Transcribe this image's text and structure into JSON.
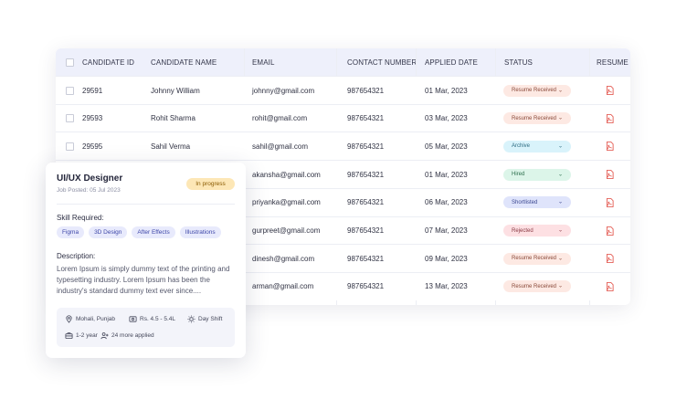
{
  "table": {
    "headers": {
      "id": "CANDIDATE ID",
      "name": "CANDIDATE NAME",
      "email": "EMAIL",
      "contact": "CONTACT NUMBER",
      "applied": "APPLIED DATE",
      "status": "STATUS",
      "resume": "RESUME"
    },
    "rows": [
      {
        "id": "29591",
        "name": "Johnny William",
        "email": "johnny@gmail.com",
        "contact": "987654321",
        "applied": "01 Mar, 2023",
        "status": "Resume Received",
        "status_color": "#fde9e3",
        "status_text": "#8a4a3a",
        "resume_icon": "pdf-icon"
      },
      {
        "id": "29593",
        "name": "Rohit Sharma",
        "email": "rohit@gmail.com",
        "contact": "987654321",
        "applied": "03 Mar, 2023",
        "status": "Resume Received",
        "status_color": "#fde9e3",
        "status_text": "#8a4a3a",
        "resume_icon": "pdf-icon"
      },
      {
        "id": "29595",
        "name": "Sahil Verma",
        "email": "sahil@gmail.com",
        "contact": "987654321",
        "applied": "05 Mar, 2023",
        "status": "Archive",
        "status_color": "#d9f3fb",
        "status_text": "#2b6b80",
        "resume_icon": "pdf-icon"
      },
      {
        "id": "",
        "name": "",
        "email": "akansha@gmail.com",
        "contact": "987654321",
        "applied": "01 Mar, 2023",
        "status": "Hired",
        "status_color": "#dcf5e9",
        "status_text": "#2b6e4c",
        "resume_icon": "pdf-icon"
      },
      {
        "id": "",
        "name": "",
        "email": "priyanka@gmail.com",
        "contact": "987654321",
        "applied": "06 Mar, 2023",
        "status": "Shortlisted",
        "status_color": "#dfe4fb",
        "status_text": "#3a4690",
        "resume_icon": "pdf-icon"
      },
      {
        "id": "",
        "name": "",
        "email": "gurpreet@gmail.com",
        "contact": "987654321",
        "applied": "07 Mar, 2023",
        "status": "Rejected",
        "status_color": "#fde0e3",
        "status_text": "#8a3a44",
        "resume_icon": "pdf-icon"
      },
      {
        "id": "",
        "name": "",
        "email": "dinesh@gmail.com",
        "contact": "987654321",
        "applied": "09 Mar, 2023",
        "status": "Resume Received",
        "status_color": "#fde9e3",
        "status_text": "#8a4a3a",
        "resume_icon": "pdf-icon"
      },
      {
        "id": "",
        "name": "",
        "email": "arman@gmail.com",
        "contact": "987654321",
        "applied": "13 Mar, 2023",
        "status": "Resume Received",
        "status_color": "#fde9e3",
        "status_text": "#8a4a3a",
        "resume_icon": "pdf-icon"
      }
    ]
  },
  "job_card": {
    "title": "UI/UX Designer",
    "posted": "Job Posted: 05 Jul 2023",
    "badge": "In progress",
    "skill_label": "Skill Required:",
    "skills": [
      "Figma",
      "3D Design",
      "After Effects",
      "Illustrations"
    ],
    "desc_label": "Description:",
    "description": "Lorem Ipsum is simply dummy text of the printing and typesetting industry. Lorem Ipsum has been the industry's standard dummy text ever since....",
    "location": "Mohali, Punjab",
    "salary": "Rs. 4.5 - 5.4L",
    "shift": "Day Shift",
    "experience": "1-2 year",
    "applied": "24 more applied"
  },
  "colors": {
    "header_bg": "#eef0fb",
    "badge_bg": "#fde7b6",
    "skill_bg": "#e8eafc",
    "pdf_red": "#e0463c"
  }
}
